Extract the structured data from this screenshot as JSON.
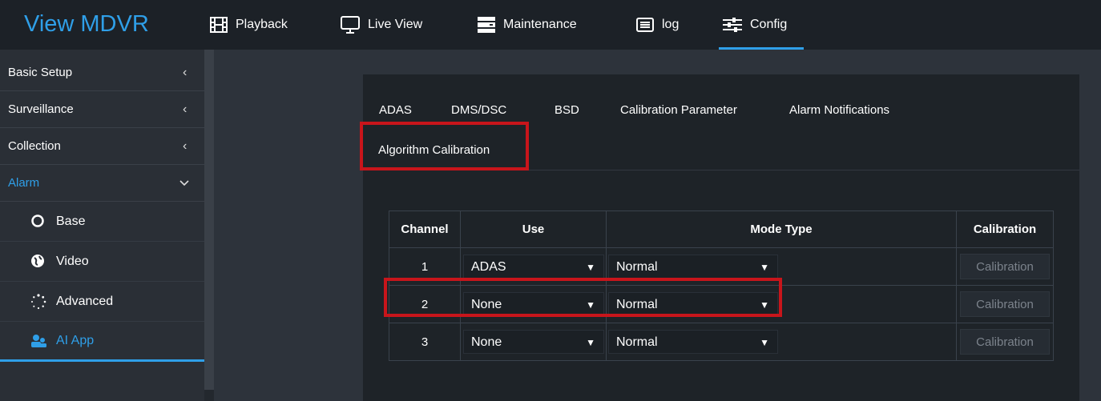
{
  "app": {
    "title": "View MDVR"
  },
  "nav": {
    "items": [
      {
        "label": "Playback",
        "icon": "film-icon"
      },
      {
        "label": "Live View",
        "icon": "monitor-icon"
      },
      {
        "label": "Maintenance",
        "icon": "server-icon"
      },
      {
        "label": "log",
        "icon": "list-icon"
      },
      {
        "label": "Config",
        "icon": "sliders-icon",
        "active": true
      }
    ]
  },
  "sidebar": {
    "items": [
      {
        "label": "Basic Setup",
        "chevron": "<"
      },
      {
        "label": "Surveillance",
        "chevron": "<"
      },
      {
        "label": "Collection",
        "chevron": "<"
      },
      {
        "label": "Alarm",
        "chevron": "v",
        "active": true
      }
    ],
    "subitems": [
      {
        "label": "Base",
        "icon": "circle-icon"
      },
      {
        "label": "Video",
        "icon": "globe-icon"
      },
      {
        "label": "Advanced",
        "icon": "spinner-icon"
      },
      {
        "label": "AI App",
        "icon": "users-icon",
        "active": true
      }
    ]
  },
  "tabs": [
    {
      "label": "ADAS"
    },
    {
      "label": "DMS/DSC"
    },
    {
      "label": "BSD"
    },
    {
      "label": "Calibration Parameter"
    },
    {
      "label": "Alarm Notifications"
    },
    {
      "label": "Algorithm Calibration",
      "active": true
    }
  ],
  "table": {
    "headers": {
      "channel": "Channel",
      "use": "Use",
      "mode_type": "Mode Type",
      "calibration": "Calibration"
    },
    "rows": [
      {
        "channel": "1",
        "use": "ADAS",
        "mode": "Normal",
        "button": "Calibration"
      },
      {
        "channel": "2",
        "use": "None",
        "mode": "Normal",
        "button": "Calibration"
      },
      {
        "channel": "3",
        "use": "None",
        "mode": "Normal",
        "button": "Calibration"
      }
    ]
  },
  "colors": {
    "accent": "#2f9fe8",
    "highlight": "#c8151b",
    "topbar": "#1c2127",
    "panel": "#1e2328"
  }
}
